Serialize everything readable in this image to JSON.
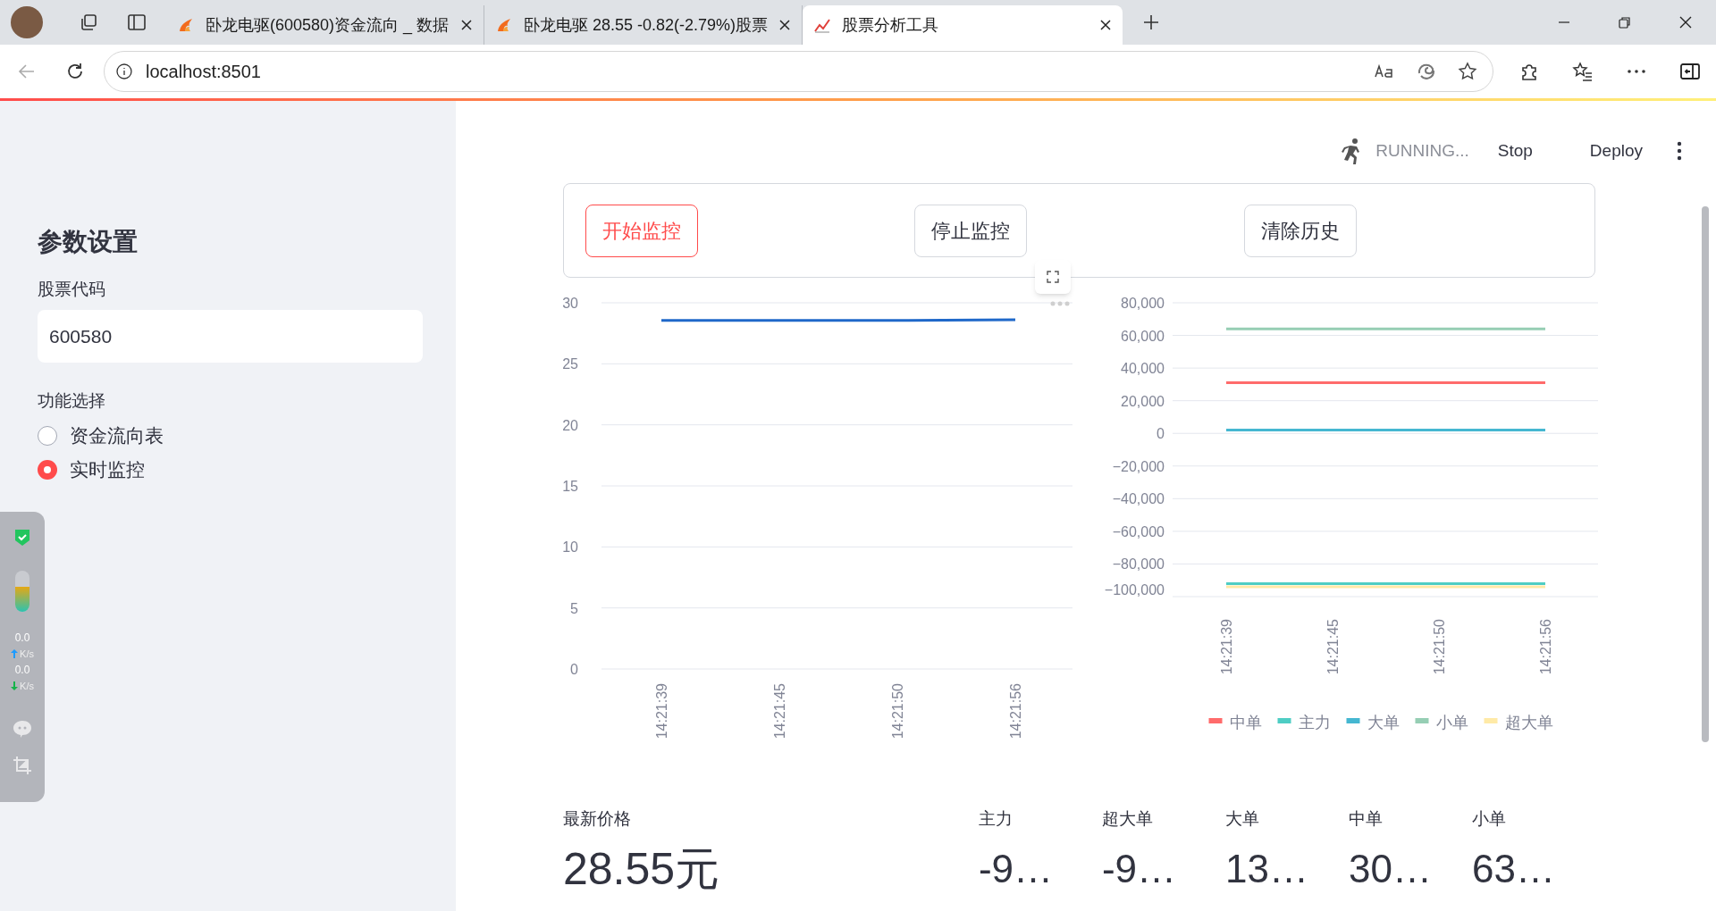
{
  "browser": {
    "tabs": [
      {
        "title": "卧龙电驱(600580)资金流向 _ 数据",
        "selected": false,
        "kind": "flame"
      },
      {
        "title": "卧龙电驱 28.55 -0.82(-2.79%)股票",
        "selected": false,
        "kind": "flame"
      },
      {
        "title": "股票分析工具",
        "selected": true,
        "kind": "chart"
      }
    ],
    "address": "localhost:8501"
  },
  "sidebar": {
    "title": "参数设置",
    "stock_code": {
      "label": "股票代码",
      "value": "600580"
    },
    "function": {
      "label": "功能选择",
      "options": [
        {
          "label": "资金流向表",
          "selected": false
        },
        {
          "label": "实时监控",
          "selected": true
        }
      ]
    }
  },
  "status_widget": {
    "rates": [
      {
        "value": "0.0",
        "unit": "K/s",
        "kind": "up"
      },
      {
        "value": "0.0",
        "unit": "K/s",
        "kind": "down"
      }
    ]
  },
  "header": {
    "status": "RUNNING...",
    "stop": "Stop",
    "deploy": "Deploy"
  },
  "buttons": [
    {
      "label": "开始监控",
      "focused": true
    },
    {
      "label": "停止监控",
      "focused": false
    },
    {
      "label": "清除历史",
      "focused": false
    }
  ],
  "price_chart": {
    "chart_data": {
      "type": "line",
      "grid": true,
      "categories": [
        "14:21:39",
        "14:21:45",
        "14:21:50",
        "14:21:56"
      ],
      "ylim": [
        0,
        30
      ],
      "yticks": [
        0,
        5,
        10,
        15,
        20,
        25,
        30
      ],
      "series": [
        {
          "color": "#1f68c9",
          "values": [
            28.55,
            28.55,
            28.55,
            28.6
          ]
        }
      ]
    }
  },
  "flow_chart": {
    "chart_data": {
      "type": "line",
      "grid": true,
      "legend": "bottom",
      "categories": [
        "14:21:39",
        "14:21:45",
        "14:21:50",
        "14:21:56"
      ],
      "ylim": [
        -100000,
        80000
      ],
      "yticks": [
        {
          "value": 80000,
          "label": "80,000"
        },
        {
          "value": 60000,
          "label": "60,000"
        },
        {
          "value": 40000,
          "label": "40,000"
        },
        {
          "value": 20000,
          "label": "20,000"
        },
        {
          "value": 0,
          "label": "0"
        },
        {
          "value": -20000,
          "label": "−20,000"
        },
        {
          "value": -40000,
          "label": "−40,000"
        },
        {
          "value": -60000,
          "label": "−60,000"
        },
        {
          "value": -80000,
          "label": "−80,000"
        },
        {
          "value": -100000,
          "label": "−100,000"
        }
      ],
      "series": [
        {
          "name": "中单",
          "color": "#ff6b6b",
          "values": [
            31000,
            31000,
            31000,
            31000
          ]
        },
        {
          "name": "主力",
          "color": "#4ecdc4",
          "values": [
            -92000,
            -92000,
            -92000,
            -92000
          ]
        },
        {
          "name": "大单",
          "color": "#45b7d1",
          "values": [
            2000,
            2000,
            2000,
            2000
          ]
        },
        {
          "name": "小单",
          "color": "#96ceb4",
          "values": [
            64000,
            64000,
            64000,
            64000
          ]
        },
        {
          "name": "超大单",
          "color": "#ffeaa7",
          "values": [
            -94000,
            -94000,
            -94000,
            -94000
          ]
        }
      ]
    }
  },
  "metrics": [
    {
      "label": "最新价格",
      "value": "28.55元"
    },
    {
      "label": "主力",
      "value": "-9…"
    },
    {
      "label": "超大单",
      "value": "-9…"
    },
    {
      "label": "大单",
      "value": "13…"
    },
    {
      "label": "中单",
      "value": "30…"
    },
    {
      "label": "小单",
      "value": "63…"
    }
  ]
}
